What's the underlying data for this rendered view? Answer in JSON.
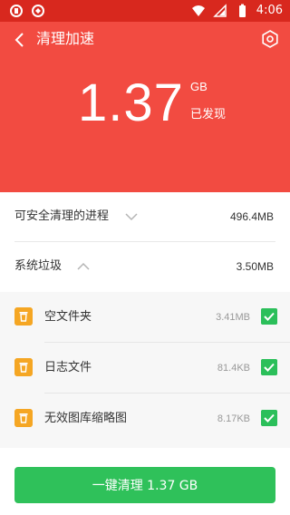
{
  "status_bar": {
    "time": "4:06",
    "icons": [
      "app-icon-1",
      "app-icon-2",
      "wifi-icon",
      "signal-icon",
      "battery-icon"
    ]
  },
  "header": {
    "title": "清理加速",
    "found_size": "1.37",
    "found_unit": "GB",
    "found_caption": "已发现",
    "background_color": "#f24b41"
  },
  "sections": [
    {
      "label": "可安全清理的进程",
      "value": "496.4MB",
      "expanded": false
    },
    {
      "label": "系统垃圾",
      "value": "3.50MB",
      "expanded": true
    }
  ],
  "junk_items": [
    {
      "name": "空文件夹",
      "size": "3.41MB",
      "checked": true
    },
    {
      "name": "日志文件",
      "size": "81.4KB",
      "checked": true
    },
    {
      "name": "无效图库缩略图",
      "size": "8.17KB",
      "checked": true
    }
  ],
  "action": {
    "clean_label": "一键清理 1.37 GB",
    "color": "#2fc15a"
  }
}
